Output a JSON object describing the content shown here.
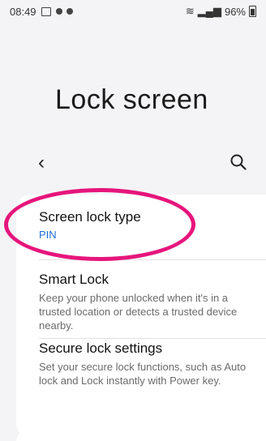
{
  "status_bar": {
    "time": "08:49",
    "battery": "96%"
  },
  "header": {
    "title": "Lock screen"
  },
  "items": [
    {
      "title": "Screen lock type",
      "subtitle": "PIN"
    },
    {
      "title": "Smart Lock",
      "description": "Keep your phone unlocked when it's in a trusted location or detects a trusted device nearby."
    },
    {
      "title": "Secure lock settings",
      "description": "Set your secure lock functions, such as Auto lock and Lock instantly with Power key."
    }
  ],
  "colors": {
    "accent": "#1f6fd6",
    "annotation": "#e6157c",
    "background": "#f4f4f6"
  },
  "icons": [
    "notification-icon",
    "back-icon",
    "search-icon",
    "battery-icon",
    "wifi-icon",
    "signal-icon"
  ]
}
